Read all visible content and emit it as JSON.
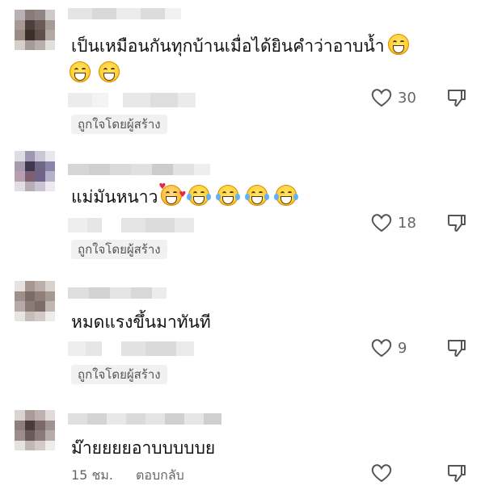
{
  "comments": [
    {
      "text": "เป็นเหมือนกันทุกบ้านเมื่อได้ยินคำว่าอาบน้ำ",
      "like_count": "30",
      "liked_by_label": "ถูกใจโดยผู้สร้าง",
      "emoji": [
        "grin-icon",
        "grin-icon",
        "grin-icon"
      ]
    },
    {
      "text": "แม่มันหนาว",
      "like_count": "18",
      "liked_by_label": "ถูกใจโดยผู้สร้าง",
      "emoji": [
        "smiling-hearts-icon",
        "tears-of-joy-icon",
        "tears-of-joy-icon",
        "tears-of-joy-icon",
        "tears-of-joy-icon"
      ]
    },
    {
      "text": "หมดแรงขึ้นมาทันที",
      "like_count": "9",
      "liked_by_label": "ถูกใจโดยผู้สร้าง"
    },
    {
      "text": "ม๊ายยยยอาบบบบบย",
      "timestamp": "15 ชม.",
      "reply_label": "ตอบกลับ"
    }
  ],
  "colors": {
    "text": "#111111",
    "secondary": "#666666",
    "badge_bg": "#f1f1f2",
    "icon_stroke": "#555555"
  }
}
